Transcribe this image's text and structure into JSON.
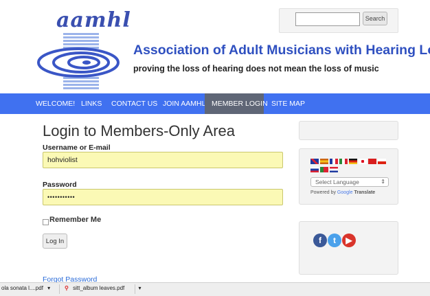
{
  "header": {
    "logo_text": "aamhl",
    "site_title": "Association of Adult Musicians with Hearing Loss",
    "tagline": "proving the loss of hearing does not mean the loss of music",
    "search_button": "Search",
    "search_value": ""
  },
  "nav": {
    "items": [
      {
        "label": "WELCOME!"
      },
      {
        "label": "LINKS"
      },
      {
        "label": "CONTACT US"
      },
      {
        "label": "JOIN AAMHL"
      },
      {
        "label": "MEMBER LOGIN"
      },
      {
        "label": "SITE MAP"
      }
    ],
    "active_color": "#5f6676",
    "bar_color": "#4071f0"
  },
  "login": {
    "title": "Login to Members-Only Area",
    "username_label": "Username or E-mail",
    "username_value": "hohviolist",
    "password_label": "Password",
    "password_value": "•••••••••••",
    "remember_label": "Remember Me",
    "login_button": "Log In",
    "forgot_link": "Forgot Password"
  },
  "sidebar": {
    "translate_select": "Select Language",
    "powered_by": "Powered by",
    "google": "Google",
    "translate": "Translate"
  },
  "social": {
    "icons": [
      "facebook-icon",
      "twitter-icon",
      "youtube-icon"
    ]
  },
  "downloads": {
    "items": [
      {
        "name": "ola sonata l....pdf"
      },
      {
        "name": "sitt_album leaves.pdf"
      }
    ]
  }
}
